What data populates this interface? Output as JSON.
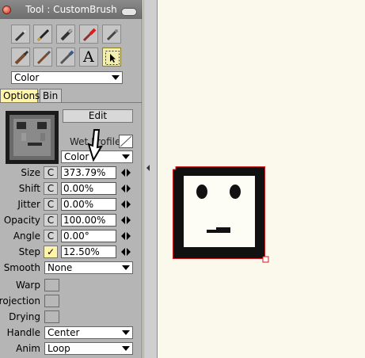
{
  "window": {
    "title": "Tool : CustomBrush"
  },
  "tools": [
    "pencil-tool-icon",
    "pen-tool-icon",
    "marker-tool-icon",
    "paint-brush-tool-icon",
    "quill-tool-icon",
    "flat-brush-tool-icon",
    "round-brush-tool-icon",
    "fan-brush-tool-icon",
    "text-tool-icon",
    "select-tool-icon"
  ],
  "text_tool_glyph": "A",
  "color_select": {
    "value": "Color"
  },
  "tabs": {
    "options": "Options",
    "bin": "Bin"
  },
  "edit_button": "Edit",
  "wet_profile": {
    "label": "Wet Profile"
  },
  "color_mode_select": {
    "value": "Color"
  },
  "params": {
    "size": {
      "label": "Size",
      "c": "C",
      "value": "373.79%"
    },
    "shift": {
      "label": "Shift",
      "c": "C",
      "value": "0.00%"
    },
    "jitter": {
      "label": "Jitter",
      "c": "C",
      "value": "0.00%"
    },
    "opacity": {
      "label": "Opacity",
      "c": "C",
      "value": "100.00%"
    },
    "angle": {
      "label": "Angle",
      "c": "C",
      "value": "0.00°"
    },
    "step": {
      "label": "Step",
      "c": "✓",
      "value": "12.50%"
    }
  },
  "smooth": {
    "label": "Smooth",
    "value": "None"
  },
  "warp": {
    "label": "Warp"
  },
  "projection": {
    "label": "Projection"
  },
  "drying": {
    "label": "Drying"
  },
  "handle": {
    "label": "Handle",
    "value": "Center"
  },
  "anim": {
    "label": "Anim",
    "value": "Loop"
  },
  "colors": {
    "selection_outline": "#cc1a1a",
    "active_tab": "#fff4a8"
  }
}
